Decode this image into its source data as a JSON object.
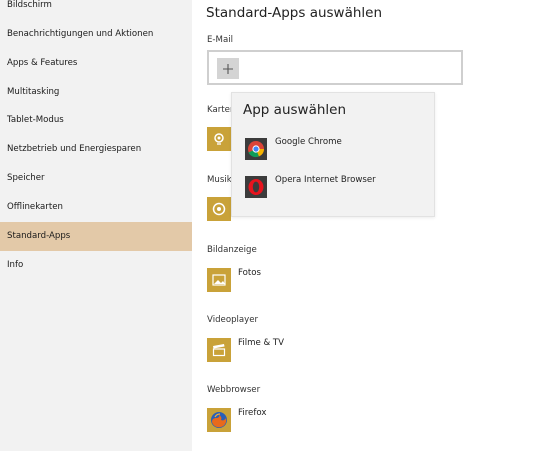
{
  "sidebar": {
    "items": [
      {
        "label": "Bildschirm"
      },
      {
        "label": "Benachrichtigungen und Aktionen"
      },
      {
        "label": "Apps & Features"
      },
      {
        "label": "Multitasking"
      },
      {
        "label": "Tablet-Modus"
      },
      {
        "label": "Netzbetrieb und Energiesparen"
      },
      {
        "label": "Speicher"
      },
      {
        "label": "Offlinekarten"
      },
      {
        "label": "Standard-Apps",
        "selected": true
      },
      {
        "label": "Info"
      }
    ],
    "selected_color": "#e3c9a8"
  },
  "main": {
    "title": "Standard-Apps auswählen",
    "email": {
      "label": "E-Mail",
      "button_icon": "plus-icon"
    },
    "sections": {
      "maps": {
        "label": "Karten",
        "icon": "maps-icon"
      },
      "music": {
        "label": "Musik",
        "icon": "music-disc-icon"
      },
      "photos": {
        "label": "Bildanzeige",
        "app": "Fotos",
        "icon": "photo-icon"
      },
      "video": {
        "label": "Videoplayer",
        "app": "Filme & TV",
        "icon": "film-clapper-icon"
      },
      "browser": {
        "label": "Webbrowser",
        "app": "Firefox",
        "icon": "firefox-icon"
      }
    },
    "tile_color": "#c9a239"
  },
  "flyout": {
    "title": "App auswählen",
    "items": [
      {
        "label": "Google Chrome",
        "icon": "chrome-icon"
      },
      {
        "label": "Opera Internet Browser",
        "icon": "opera-icon"
      }
    ]
  }
}
